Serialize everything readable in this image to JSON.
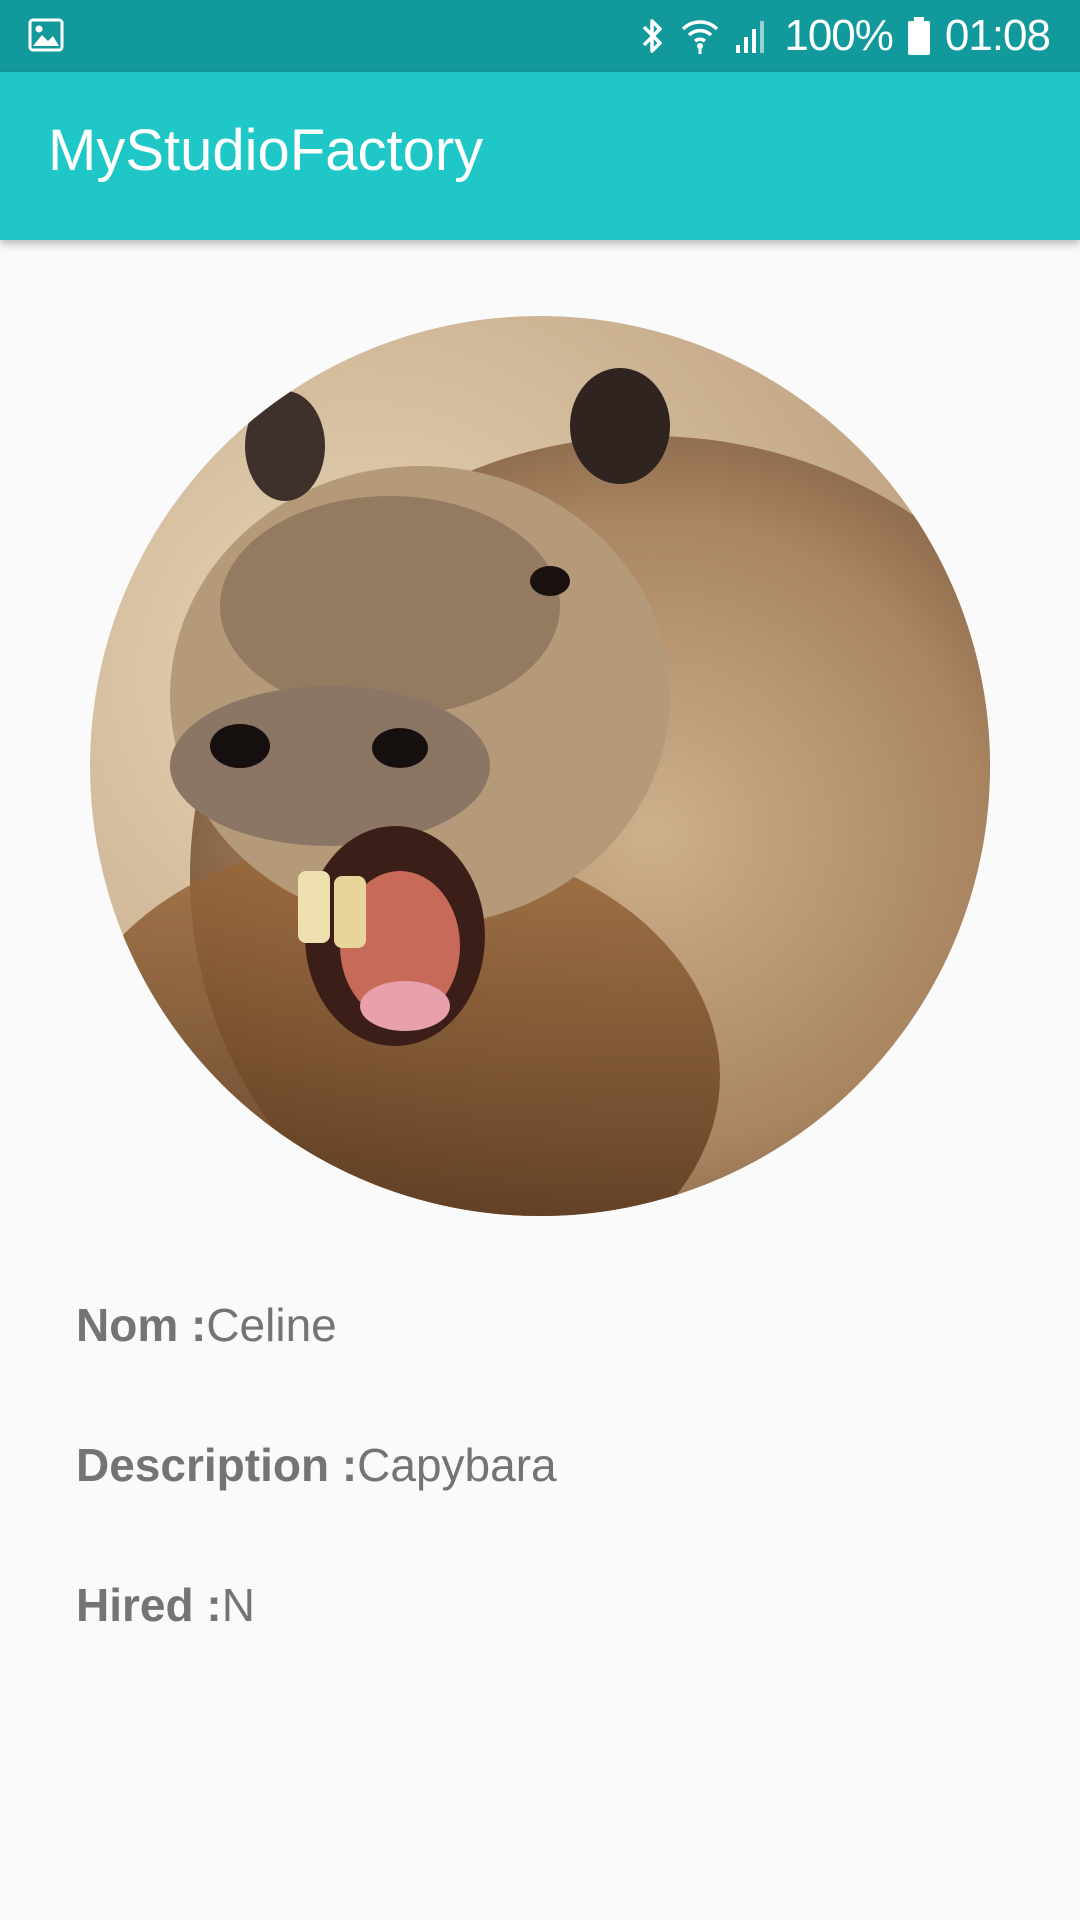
{
  "status_bar": {
    "battery": "100%",
    "time": "01:08",
    "icons": [
      "gallery-notification-icon",
      "bluetooth-icon",
      "wifi-icon",
      "signal-icon",
      "battery-icon"
    ]
  },
  "app_bar": {
    "title": "MyStudioFactory"
  },
  "profile": {
    "photo": "capybara-photo",
    "name_label": "Nom :",
    "name_value": "Celine",
    "description_label": "Description :",
    "description_value": "Capybara",
    "hired_label": "Hired :",
    "hired_value": "N"
  },
  "colors": {
    "status_bar": "#12999c",
    "app_bar": "#1fc7c7",
    "background": "#fafafa",
    "text": "#747474"
  }
}
